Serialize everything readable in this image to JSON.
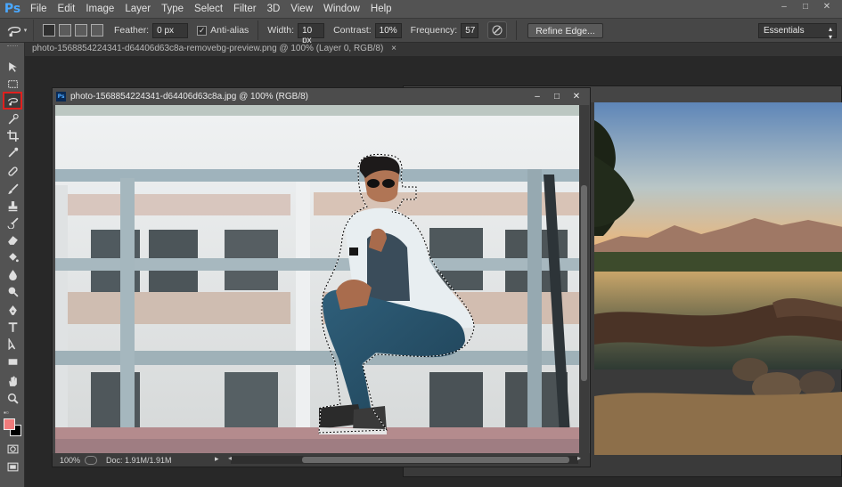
{
  "app": {
    "logo": "Ps"
  },
  "menu": [
    "File",
    "Edit",
    "Image",
    "Layer",
    "Type",
    "Select",
    "Filter",
    "3D",
    "View",
    "Window",
    "Help"
  ],
  "window_controls": [
    "–",
    "□",
    "✕"
  ],
  "options": {
    "feather_label": "Feather:",
    "feather_value": "0 px",
    "antialias_label": "Anti-alias",
    "antialias_checked": true,
    "width_label": "Width:",
    "width_value": "10 px",
    "contrast_label": "Contrast:",
    "contrast_value": "10%",
    "frequency_label": "Frequency:",
    "frequency_value": "57",
    "refine_edge_label": "Refine Edge...",
    "workspace_value": "Essentials"
  },
  "tab": {
    "title": "photo-1568854224341-d64406d63c8a-removebg-preview.png @ 100% (Layer 0, RGB/8)",
    "close": "×"
  },
  "tools": [
    "move-tool-icon",
    "marquee-tool-icon",
    "magnetic-lasso-tool-icon",
    "quick-selection-tool-icon",
    "crop-tool-icon",
    "eyedropper-tool-icon",
    "healing-brush-tool-icon",
    "brush-tool-icon",
    "clone-stamp-tool-icon",
    "history-brush-tool-icon",
    "eraser-tool-icon",
    "paint-bucket-tool-icon",
    "blur-tool-icon",
    "dodge-tool-icon",
    "pen-tool-icon",
    "type-tool-icon",
    "path-selection-tool-icon",
    "rectangle-tool-icon",
    "hand-tool-icon",
    "zoom-tool-icon"
  ],
  "colors": {
    "foreground": "#f07b7b",
    "background": "#000000",
    "selected_tool_outline": "#e0201e"
  },
  "document": {
    "title": "photo-1568854224341-d64406d63c8a.jpg @ 100% (RGB/8)",
    "controls": [
      "–",
      "□",
      "✕"
    ],
    "zoom": "100%",
    "doc_info": "Doc: 1.91M/1.91M"
  }
}
